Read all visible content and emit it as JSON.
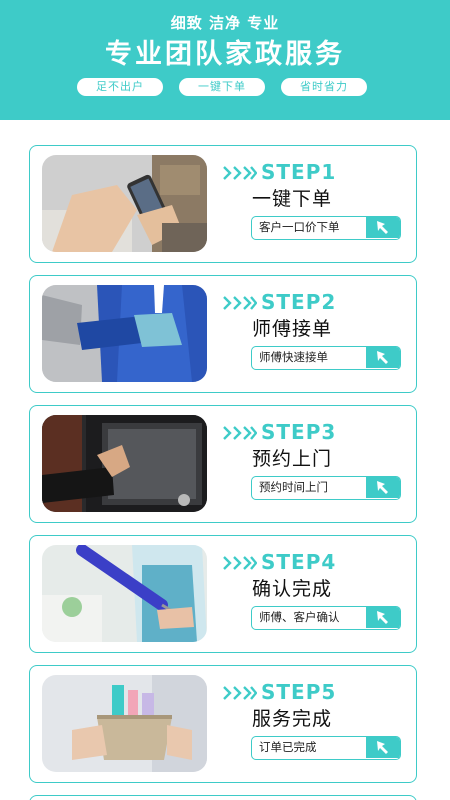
{
  "header": {
    "tagline": "细致 洁净 专业",
    "title": "专业团队家政服务",
    "pills": [
      "足不出户",
      "一键下单",
      "省时省力"
    ]
  },
  "steps": [
    {
      "step": "STEP1",
      "title": "一键下单",
      "action": "客户一口价下单",
      "photo": "phone-hands-photo"
    },
    {
      "step": "STEP2",
      "title": "师傅接单",
      "action": "师傅快速接单",
      "photo": "worker-apron-photo"
    },
    {
      "step": "STEP3",
      "title": "预约上门",
      "action": "预约时间上门",
      "photo": "door-knock-photo"
    },
    {
      "step": "STEP4",
      "title": "确认完成",
      "action": "师傅、客户确认",
      "photo": "duster-cleaner-photo"
    },
    {
      "step": "STEP5",
      "title": "服务完成",
      "action": "订单已完成",
      "photo": "cleaning-basket-photo"
    }
  ],
  "colors": {
    "accent": "#3ecbc8",
    "text": "#111111",
    "background": "#ffffff"
  },
  "icons": {
    "chevrons": "triple-chevron-icon",
    "cursor": "cursor-arrow-icon"
  }
}
